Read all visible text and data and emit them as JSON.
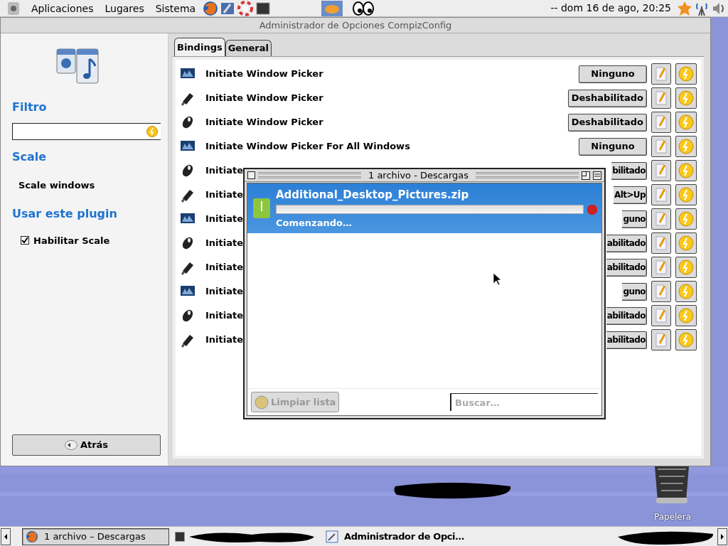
{
  "top_panel": {
    "menus": [
      "Aplicaciones",
      "Lugares",
      "Sistema"
    ],
    "clock": "-- dom 16 de ago, 20:25"
  },
  "window": {
    "title": "Administrador de Opciones CompizConfig",
    "sidebar": {
      "filter_label": "Filtro",
      "plugin_title": "Scale",
      "plugin_description": "Scale windows",
      "use_title": "Usar este plugin",
      "enable_checkbox": {
        "label": "Habilitar Scale",
        "checked": true
      },
      "back_button": "Atrás"
    },
    "tabs": [
      {
        "label": "Bindings",
        "selected": true
      },
      {
        "label": "General",
        "selected": false
      }
    ],
    "rows": [
      {
        "kind": "screen",
        "label": "Initiate Window Picker",
        "binding": "Ninguno",
        "cut": false
      },
      {
        "kind": "key",
        "label": "Initiate Window Picker",
        "binding": "Deshabilitado",
        "cut": false
      },
      {
        "kind": "button",
        "label": "Initiate Window Picker",
        "binding": "Deshabilitado",
        "cut": false
      },
      {
        "kind": "screen",
        "label": "Initiate Window Picker For All Windows",
        "binding": "Ninguno",
        "cut": false
      },
      {
        "kind": "button",
        "label": "Initiate",
        "binding": "bilitado",
        "cut": true
      },
      {
        "kind": "key",
        "label": "Initiate",
        "binding": "Alt>Up",
        "cut": true
      },
      {
        "kind": "screen",
        "label": "Initiate",
        "binding": "guno",
        "cut": true
      },
      {
        "kind": "button",
        "label": "Initiate",
        "binding": "abilitado",
        "cut": true
      },
      {
        "kind": "key",
        "label": "Initiate",
        "binding": "abilitado",
        "cut": true
      },
      {
        "kind": "screen",
        "label": "Initiate",
        "binding": "guno",
        "cut": true
      },
      {
        "kind": "button",
        "label": "Initiate",
        "binding": "abilitado",
        "cut": true
      },
      {
        "kind": "key",
        "label": "Initiate",
        "binding": "abilitado",
        "cut": true
      }
    ]
  },
  "downloads_window": {
    "title": "1 archivo - Descargas",
    "items": [
      {
        "filename": "Additional_Desktop_Pictures.zip",
        "status": "Comenzando…",
        "level": 0,
        "selected": true
      }
    ],
    "clear_button": {
      "label": "Limpiar lista",
      "disabled": true
    },
    "search": {
      "placeholder": "Buscar…"
    }
  },
  "desktop": {
    "trash_label": "Papelera"
  },
  "taskbar": {
    "tasks": [
      {
        "label": "1 archivo – Descargas",
        "selected": true
      },
      {
        "label": "Administrador de Opci…",
        "selected": false
      }
    ]
  }
}
